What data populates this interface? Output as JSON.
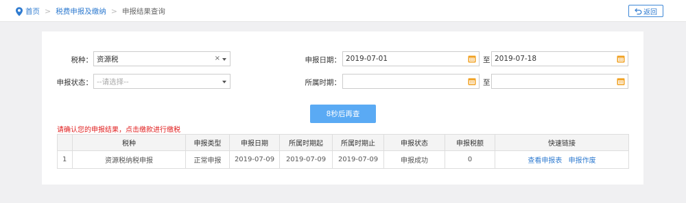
{
  "breadcrumb": {
    "home": "首页",
    "level2": "税费申报及缴纳",
    "current": "申报结果查询"
  },
  "back_button": "返回",
  "form": {
    "tax_type_label": "税种：",
    "tax_type_value": "资源税",
    "status_label": "申报状态：",
    "status_placeholder": "--请选择--",
    "declare_date_label": "申报日期：",
    "declare_date_from": "2019-07-01",
    "declare_date_to": "2019-07-18",
    "period_label": "所属时期：",
    "period_from": "",
    "period_to": "",
    "to_label": "至",
    "clear_symbol": "×"
  },
  "query_button": "8秒后再查",
  "notice": "请确认您的申报结果，点击缴款进行缴税",
  "table": {
    "headers": [
      "",
      "税种",
      "申报类型",
      "申报日期",
      "所属时期起",
      "所属时期止",
      "申报状态",
      "申报税额",
      "快速链接"
    ],
    "rows": [
      {
        "index": "1",
        "tax": "资源税纳税申报",
        "type": "正常申报",
        "date": "2019-07-09",
        "from": "2019-07-09",
        "to": "2019-07-09",
        "status": "申报成功",
        "amount": "0",
        "link1": "查看申报表",
        "link2": "申报作废"
      }
    ]
  },
  "colors": {
    "link": "#2f7bd0",
    "button": "#5aaaf4",
    "notice": "#e02020",
    "calendar": "#f0a020"
  },
  "icons": {
    "home": "location-pin-icon",
    "back": "return-arrow-icon",
    "calendar": "calendar-icon"
  }
}
